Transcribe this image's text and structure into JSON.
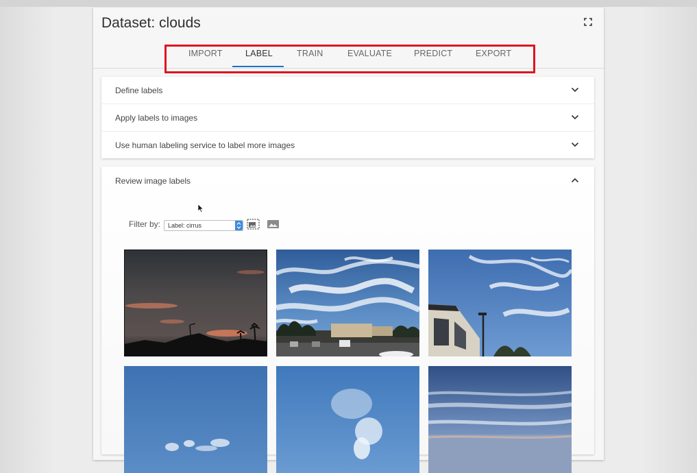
{
  "dataset": {
    "title": "Dataset: clouds"
  },
  "tabs": [
    {
      "label": "IMPORT"
    },
    {
      "label": "LABEL"
    },
    {
      "label": "TRAIN"
    },
    {
      "label": "EVALUATE"
    },
    {
      "label": "PREDICT"
    },
    {
      "label": "EXPORT"
    }
  ],
  "active_tab": "LABEL",
  "sections": [
    {
      "label": "Define labels"
    },
    {
      "label": "Apply labels to images"
    },
    {
      "label": "Use human labeling service to label more images"
    }
  ],
  "review": {
    "header": "Review image labels",
    "filter_label": "Filter by:",
    "filter_value": "Label: cirrus"
  },
  "thumbnails": [
    {
      "icon": "sunset-silhouette-image"
    },
    {
      "icon": "cirrus-parking-lot-image"
    },
    {
      "icon": "cirrus-building-image"
    },
    {
      "icon": "blue-sky-clouds-image"
    },
    {
      "icon": "blue-sky-wisp-image"
    },
    {
      "icon": "horizon-stratus-image"
    }
  ],
  "colors": {
    "accent": "#1a73c8",
    "highlight": "#e0141e"
  }
}
